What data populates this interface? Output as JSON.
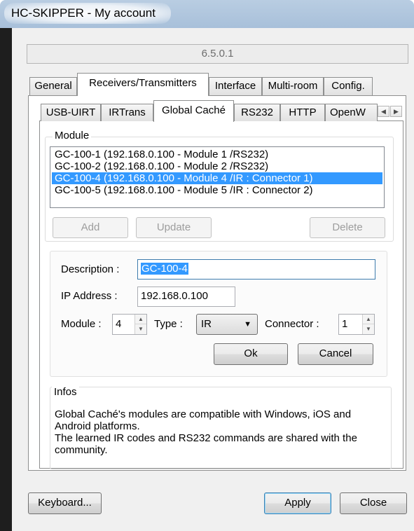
{
  "window": {
    "title": "HC-SKIPPER - My account"
  },
  "version": "6.5.0.1",
  "tabs": [
    "General",
    "Receivers/Transmitters",
    "Interface",
    "Multi-room",
    "Config."
  ],
  "subtabs": [
    "USB-UIRT",
    "IRTrans",
    "Global Caché",
    "RS232",
    "HTTP",
    "OpenW"
  ],
  "module_group": {
    "label": "Module",
    "items": [
      "GC-100-1 (192.168.0.100 - Module 1 /RS232)",
      "GC-100-2 (192.168.0.100 - Module 2 /RS232)",
      "GC-100-4 (192.168.0.100 - Module 4 /IR : Connector 1)",
      "GC-100-5 (192.168.0.100 - Module 5 /IR : Connector 2)"
    ],
    "selected_index": 2,
    "add_label": "Add",
    "update_label": "Update",
    "delete_label": "Delete"
  },
  "form": {
    "description_label": "Description :",
    "description_value": "GC-100-4",
    "ip_label": "IP Address :",
    "ip_value": "192.168.0.100",
    "module_label": "Module :",
    "module_value": "4",
    "type_label": "Type :",
    "type_value": "IR",
    "connector_label": "Connector :",
    "connector_value": "1",
    "ok_label": "Ok",
    "cancel_label": "Cancel"
  },
  "infos": {
    "label": "Infos",
    "line1": "Global Caché's modules are compatible with Windows, iOS and",
    "line2": "Android platforms.",
    "line3": "The learned IR codes and RS232 commands are shared with the",
    "line4": "community."
  },
  "footer": {
    "keyboard_label": "Keyboard...",
    "apply_label": "Apply",
    "close_label": "Close"
  },
  "colors": {
    "selection": "#3399ff",
    "titlebar": "#b9cde2"
  }
}
